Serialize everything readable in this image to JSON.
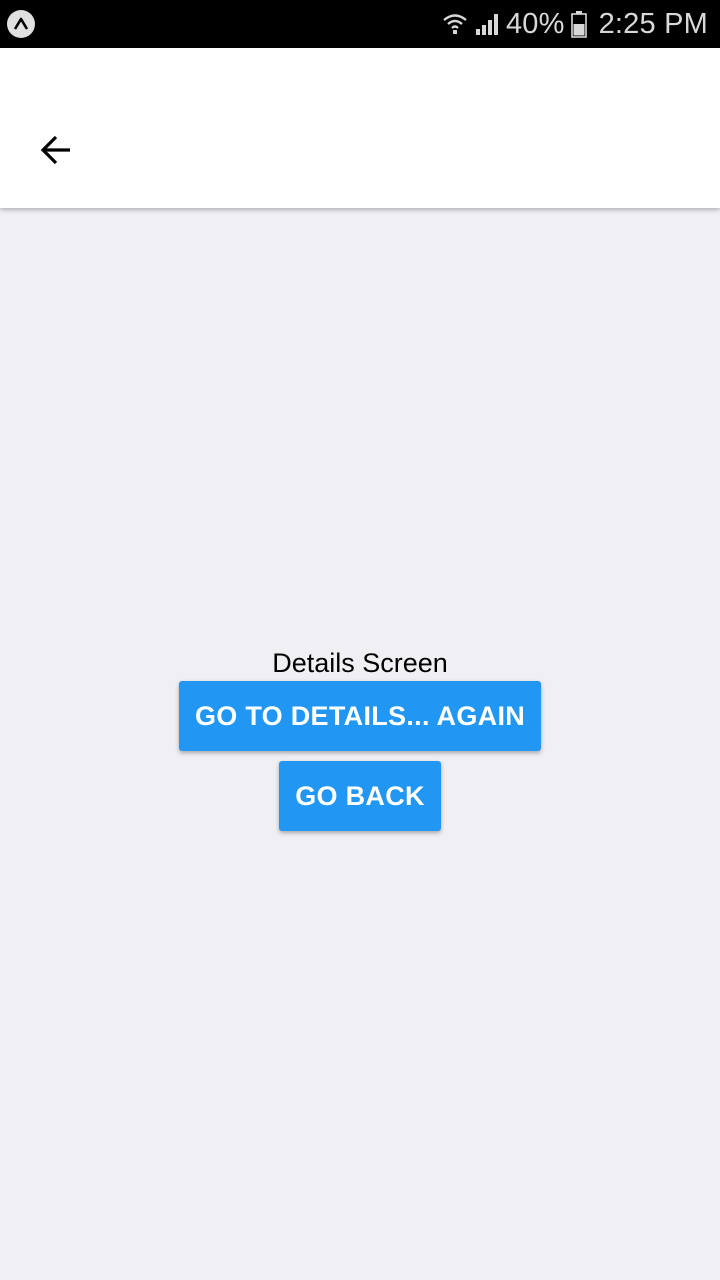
{
  "status_bar": {
    "battery_percent": "40%",
    "time": "2:25 PM",
    "app_icon": "expo-icon",
    "wifi_icon": "wifi-icon",
    "signal_icon": "signal-icon",
    "battery_icon": "battery-icon"
  },
  "header": {
    "back_icon": "arrow-left-icon"
  },
  "main": {
    "title": "Details Screen",
    "go_to_details_label": "GO TO DETAILS... AGAIN",
    "go_back_label": "GO BACK"
  },
  "colors": {
    "status_bar_bg": "#000000",
    "header_bg": "#ffffff",
    "content_bg": "#efeff4",
    "button_bg": "#2196f3",
    "button_text": "#ffffff"
  }
}
